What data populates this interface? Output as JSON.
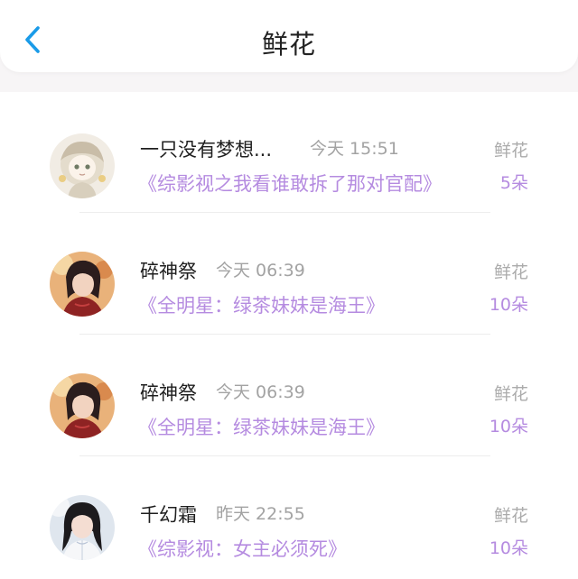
{
  "header": {
    "title": "鲜花",
    "back_icon": "chevron-left-icon",
    "accent_color": "#1a9be8"
  },
  "items": [
    {
      "name": "一只没有梦想...",
      "time": "今天 15:51",
      "book": "《综影视之我看谁敢拆了那对官配》",
      "gift_type": "鲜花",
      "gift_count": "5朵",
      "avatar": "avatar-girl-chibi"
    },
    {
      "name": "碎神祭",
      "time": "今天 06:39",
      "book": "《全明星：绿茶妹妹是海王》",
      "gift_type": "鲜花",
      "gift_count": "10朵",
      "avatar": "avatar-red-dress-girl"
    },
    {
      "name": "碎神祭",
      "time": "今天 06:39",
      "book": "《全明星：绿茶妹妹是海王》",
      "gift_type": "鲜花",
      "gift_count": "10朵",
      "avatar": "avatar-red-dress-girl"
    },
    {
      "name": "千幻霜",
      "time": "昨天 22:55",
      "book": "《综影视：女主必须死》",
      "gift_type": "鲜花",
      "gift_count": "10朵",
      "avatar": "avatar-dark-hair-girl"
    }
  ],
  "colors": {
    "link_purple": "#b58be0",
    "muted_gray": "#a3a3a3",
    "background": "#f7f5f6"
  }
}
